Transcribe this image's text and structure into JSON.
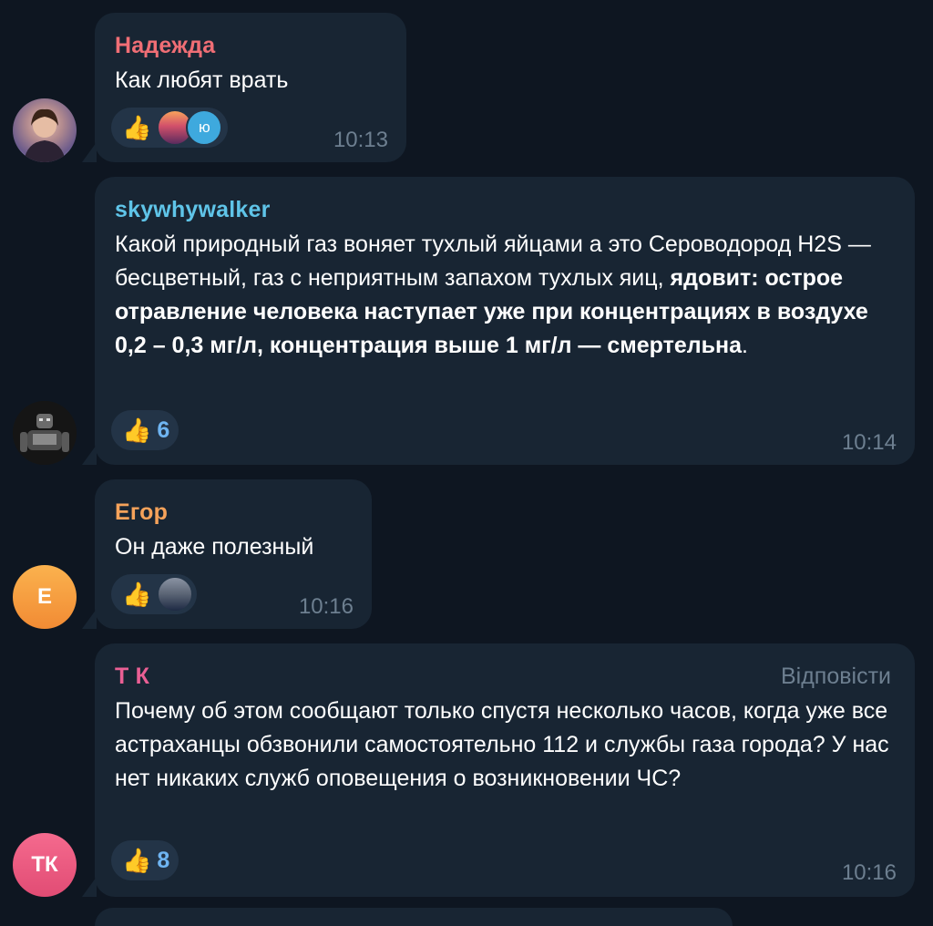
{
  "messages": [
    {
      "sender": "Надежда",
      "sender_color": "#f06e75",
      "text": "Как любят врать",
      "time": "10:13",
      "reaction_emoji": "👍",
      "mini_letter": "ю"
    },
    {
      "sender": "skywhywalker",
      "sender_color": "#5fc4e8",
      "text_plain": "Какой природный газ воняет тухлый яйцами а это Сероводород H2S —  бесцветный, газ с неприятным запахом тухлых яиц, ",
      "text_bold": "ядовит: острое отравление человека наступает уже при концентрациях в воздухе 0,2 – 0,3 мг/л, концентрация выше 1 мг/л — смертельна",
      "text_end": ".",
      "time": "10:14",
      "reaction_emoji": "👍",
      "reaction_count": "6"
    },
    {
      "sender": "Егор",
      "sender_color": "#f5a25a",
      "text": "Он даже полезный",
      "time": "10:16",
      "reaction_emoji": "👍",
      "avatar_letter": "Е",
      "avatar_color": "#f79a3e"
    },
    {
      "sender": "Т К",
      "sender_color": "#ea5f94",
      "reply_label": "Відповісти",
      "text": "Почему об этом сообщают только спустя несколько часов, когда уже все астраханцы обзвонили самостоятельно 112 и службы газа города? У нас нет никаких служб оповещения о возникновении ЧС?",
      "time": "10:16",
      "reaction_emoji": "👍",
      "reaction_count": "8",
      "avatar_letter": "ТК",
      "avatar_color": "#e8537f"
    }
  ]
}
